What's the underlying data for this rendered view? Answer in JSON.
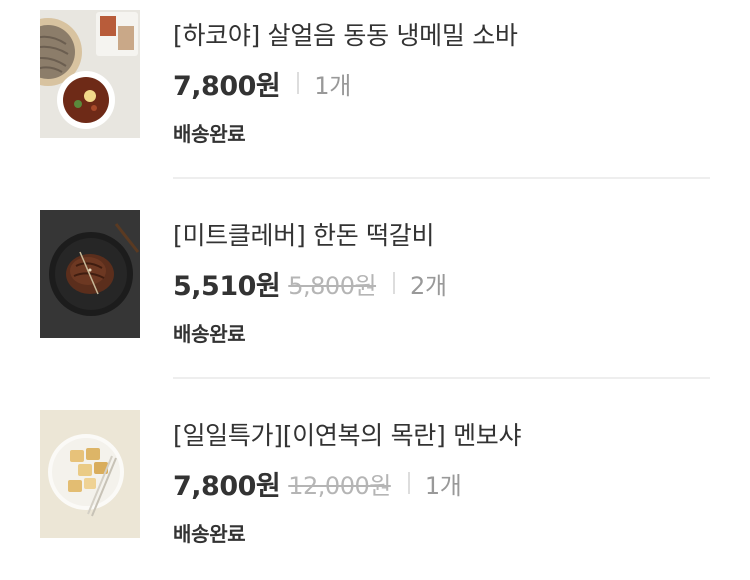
{
  "items": [
    {
      "name": "[하코야] 살얼음 동동 냉메밀 소바",
      "price": "7,800원",
      "original_price": "",
      "quantity": "1개",
      "status": "배송완료",
      "image_icon": "cold-buckwheat-soba-photo"
    },
    {
      "name": "[미트클레버] 한돈 떡갈비",
      "price": "5,510원",
      "original_price": "5,800원",
      "quantity": "2개",
      "status": "배송완료",
      "image_icon": "grilled-tteokgalbi-photo"
    },
    {
      "name": "[일일특가][이연복의 목란] 멘보샤",
      "price": "7,800원",
      "original_price": "12,000원",
      "quantity": "1개",
      "status": "배송완료",
      "image_icon": "menbosha-shrimp-toast-photo"
    }
  ],
  "colors": {
    "text_primary": "#333333",
    "text_secondary": "#999999",
    "strikethrough": "#b5b5b5",
    "separator": "#eeeeee"
  }
}
